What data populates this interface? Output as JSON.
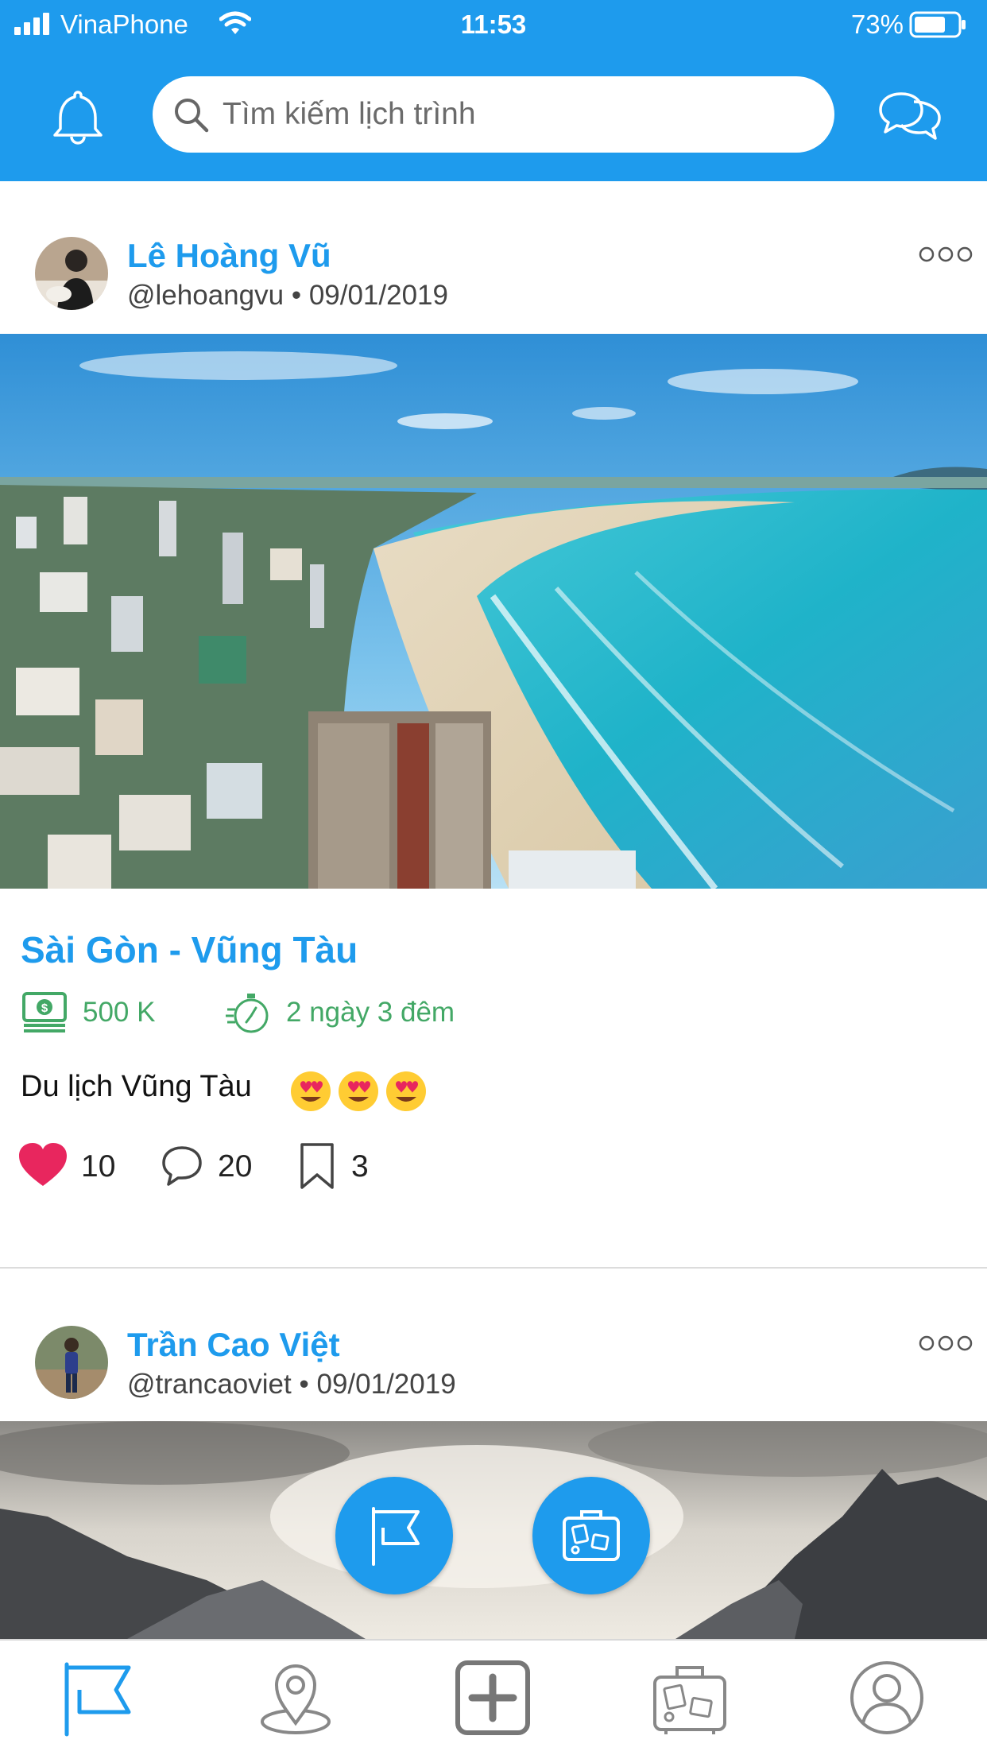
{
  "status_bar": {
    "carrier": "VinaPhone",
    "time": "11:53",
    "battery": "73%",
    "battery_level": 0.73
  },
  "header": {
    "search_placeholder": "Tìm kiếm lịch trình",
    "icons": [
      "bell-icon",
      "search-icon",
      "chat-icon"
    ]
  },
  "posts": [
    {
      "author": "Lê Hoàng Vũ",
      "handle": "@lehoangvu",
      "separator": "•",
      "date": "09/01/2019",
      "title": "Sài Gòn - Vũng Tàu",
      "budget": "500 K",
      "duration": "2 ngày 3 đêm",
      "caption": "Du lịch Vũng Tàu",
      "likes": "10",
      "comments": "20",
      "bookmarks": "3"
    },
    {
      "author": "Trần Cao Việt",
      "handle": "@trancaoviet",
      "separator": "•",
      "date": "09/01/2019"
    }
  ],
  "colors": {
    "brand": "#1e9bed",
    "info_green": "#43a866",
    "like": "#e8265e"
  },
  "tab_bar": {
    "items": [
      "flag-icon",
      "map-pin-icon",
      "add-icon",
      "luggage-icon",
      "profile-icon"
    ],
    "active_index": 0
  }
}
